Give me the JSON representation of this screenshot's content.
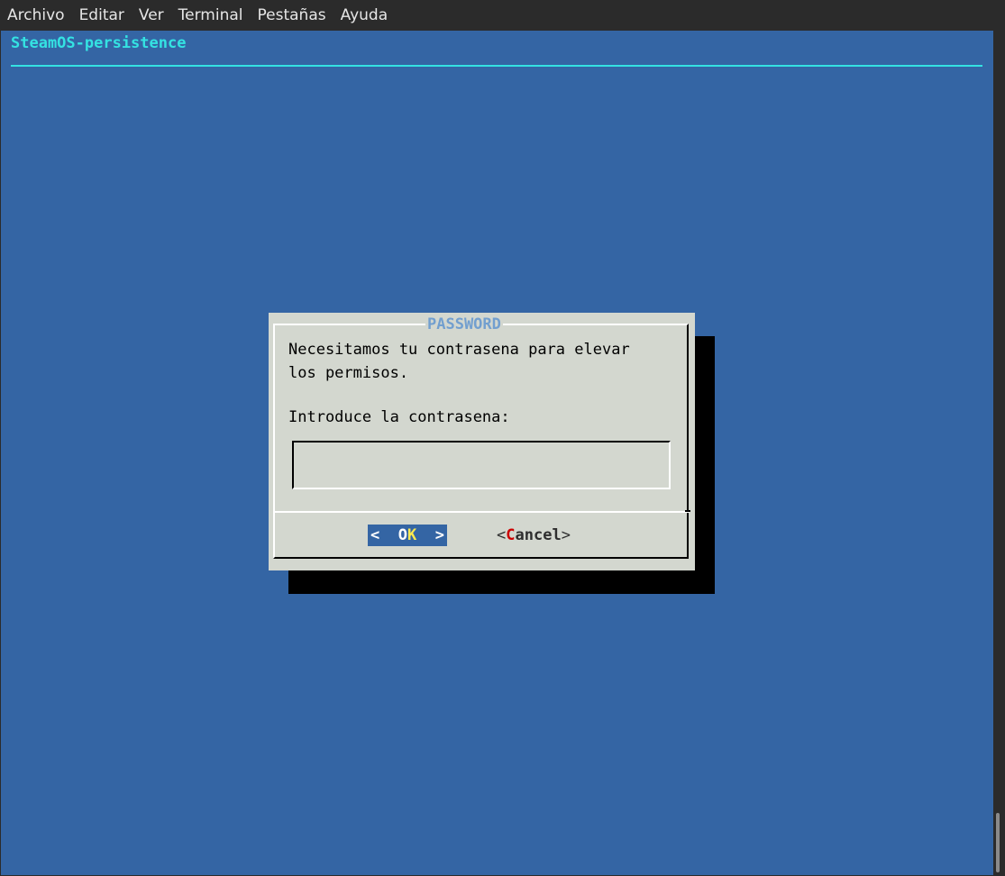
{
  "menubar": {
    "items": [
      "Archivo",
      "Editar",
      "Ver",
      "Terminal",
      "Pestañas",
      "Ayuda"
    ]
  },
  "terminal": {
    "backtitle": "SteamOS-persistence"
  },
  "dialog": {
    "title": "PASSWORD",
    "message": "Necesitamos tu contrasena para elevar\nlos permisos.",
    "prompt": "Introduce la contrasena:",
    "input_value": "",
    "ok": {
      "left": "<  O",
      "hot": "K",
      "right": "  >"
    },
    "cancel": {
      "open": "<",
      "hot": "C",
      "rest": "ancel",
      "close": ">"
    }
  },
  "colors": {
    "terminal_bg": "#3465a4",
    "dialog_bg": "#d3d7cf",
    "backtitle": "#34e2e2",
    "title": "#729fcf",
    "hotkey_ok": "#fce94f",
    "hotkey_cancel": "#cc0000"
  }
}
